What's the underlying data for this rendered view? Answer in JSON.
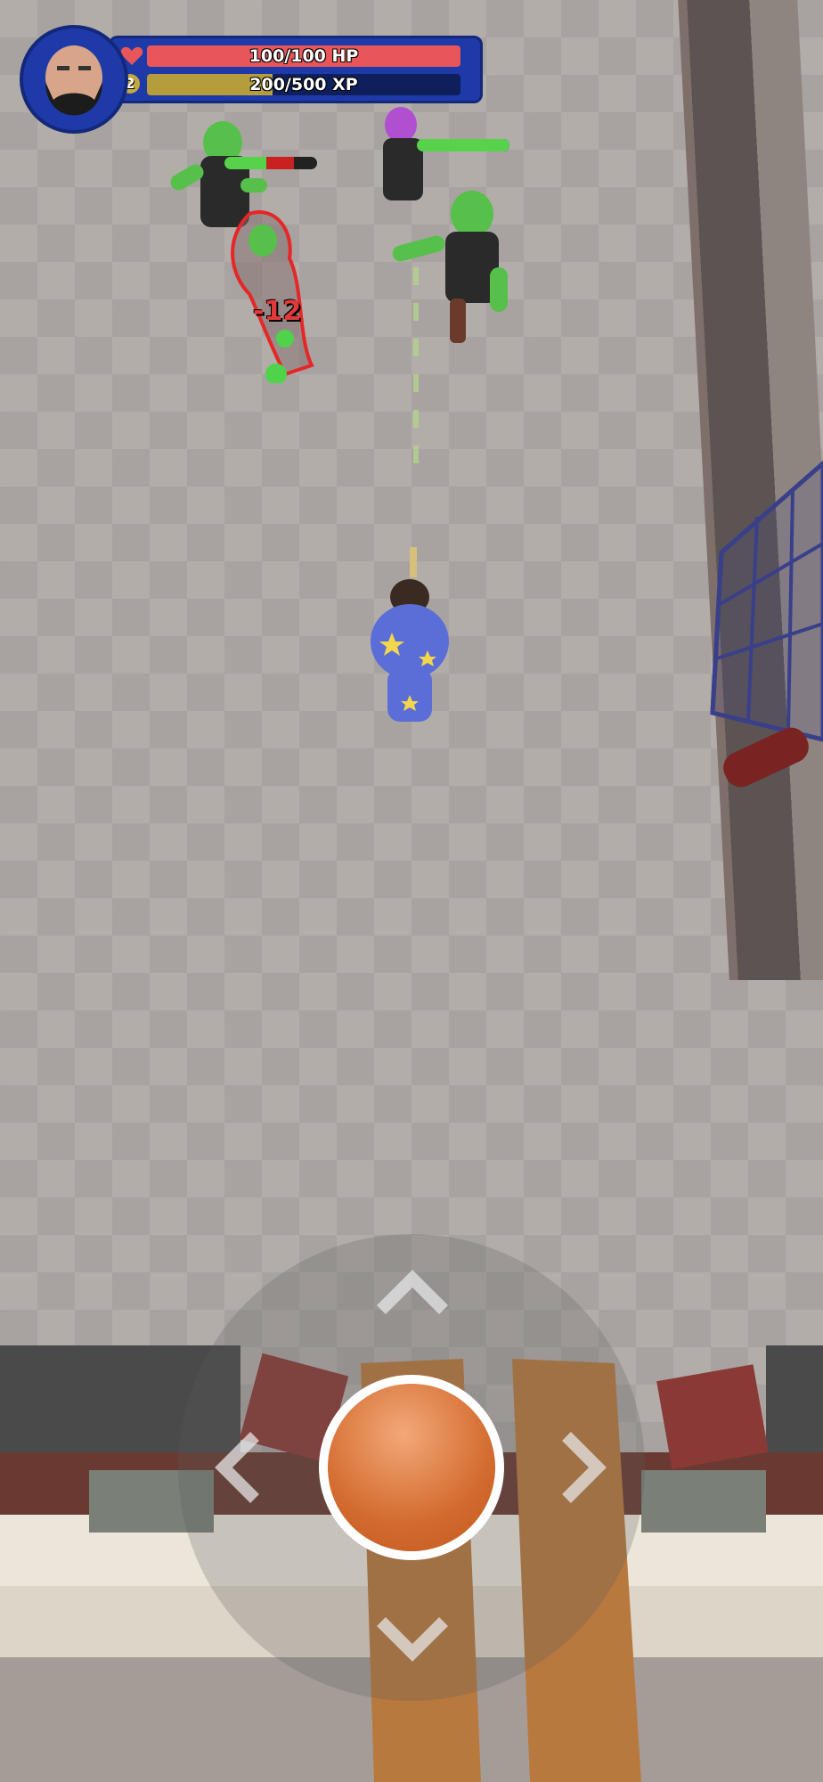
{
  "hud": {
    "hp_text": "100/100 HP",
    "hp_fraction": 1.0,
    "xp_text": "200/500 XP",
    "xp_fraction": 0.4,
    "level": "2",
    "icons": [
      "heart-icon",
      "player-avatar"
    ]
  },
  "enemies": [
    {
      "name": "zombie-1",
      "health_fraction": 0.45
    },
    {
      "name": "zombie-2",
      "health_fraction": 1.0
    }
  ],
  "damage_popup": "-12",
  "controls": {
    "joystick_icons": [
      "chevron-up-icon",
      "chevron-down-icon",
      "chevron-left-icon",
      "chevron-right-icon"
    ],
    "fire_button_color": "#d36b2f"
  },
  "colors": {
    "hp": "#e8565a",
    "xp": "#b59d3b",
    "panel": "#1e3aa8",
    "zombie_skin": "#56c04a",
    "player_pajamas": "#5b6ed8"
  }
}
